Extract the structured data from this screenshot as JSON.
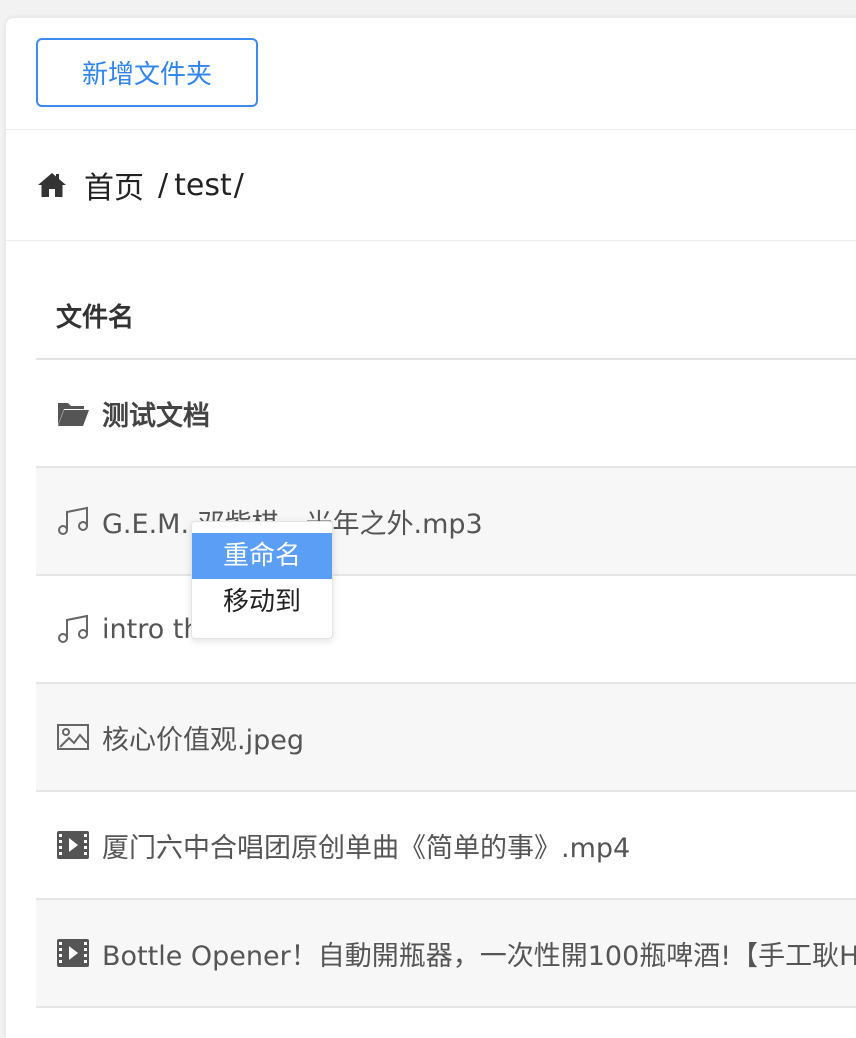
{
  "toolbar": {
    "new_folder_label": "新增文件夹",
    "accent_color": "#3c8cf0"
  },
  "breadcrumb": {
    "home": "首页",
    "sep": "/",
    "folder": "test"
  },
  "table": {
    "header": "文件名",
    "rows": [
      {
        "icon": "folder-icon",
        "name": "测试文档"
      },
      {
        "icon": "music-icon",
        "name": "G.E.M. 邓紫棋 - 光年之外.mp3"
      },
      {
        "icon": "music-icon",
        "name": "intro the ..."
      },
      {
        "icon": "image-icon",
        "name": "核心价值观.jpeg"
      },
      {
        "icon": "video-icon",
        "name": "厦门六中合唱团原创单曲《简单的事》.mp4"
      },
      {
        "icon": "video-icon",
        "name": "Bottle Opener！自動開瓶器，一次性開100瓶啤酒!【手工耿H"
      }
    ]
  },
  "context_menu": {
    "items": [
      "重命名",
      "移动到"
    ],
    "active_color": "#5a9ff5"
  }
}
